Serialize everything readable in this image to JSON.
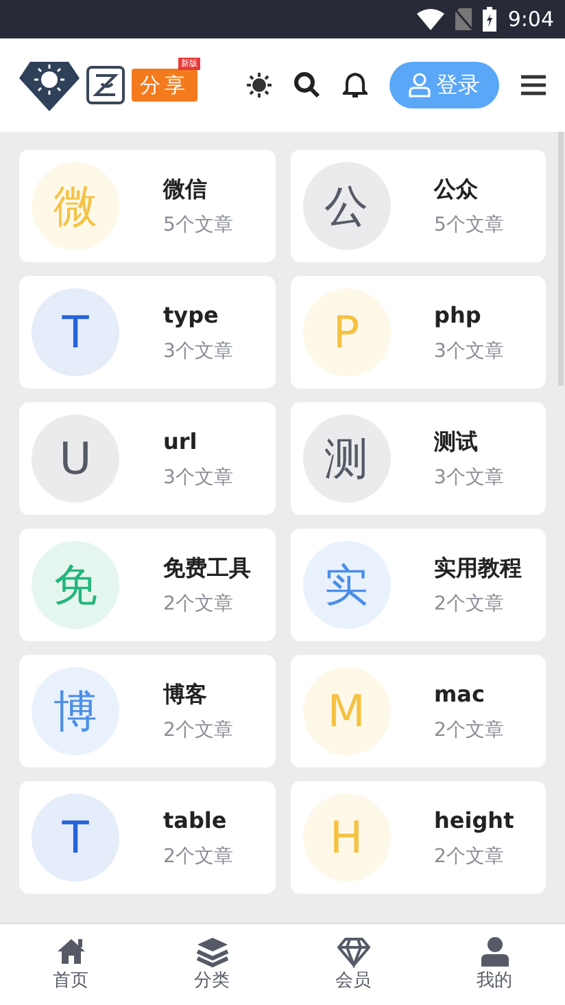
{
  "status_bar": {
    "time": "9:04"
  },
  "header": {
    "logo_text": "分享",
    "logo_tag": "新版",
    "login_label": "登录"
  },
  "categories": [
    {
      "letter": "微",
      "name": "微信",
      "count": "5个文章",
      "color": "#f5c242"
    },
    {
      "letter": "公",
      "name": "公众",
      "count": "5个文章",
      "color": "#555a66"
    },
    {
      "letter": "T",
      "name": "type",
      "count": "3个文章",
      "color": "#2563d9"
    },
    {
      "letter": "P",
      "name": "php",
      "count": "3个文章",
      "color": "#f5c242"
    },
    {
      "letter": "U",
      "name": "url",
      "count": "3个文章",
      "color": "#555a66"
    },
    {
      "letter": "测",
      "name": "测试",
      "count": "3个文章",
      "color": "#555a66"
    },
    {
      "letter": "免",
      "name": "免费工具",
      "count": "2个文章",
      "color": "#23b67a"
    },
    {
      "letter": "实",
      "name": "实用教程",
      "count": "2个文章",
      "color": "#4a8ee8"
    },
    {
      "letter": "博",
      "name": "博客",
      "count": "2个文章",
      "color": "#4a8ee8"
    },
    {
      "letter": "M",
      "name": "mac",
      "count": "2个文章",
      "color": "#f5c242"
    },
    {
      "letter": "T",
      "name": "table",
      "count": "2个文章",
      "color": "#2563d9"
    },
    {
      "letter": "H",
      "name": "height",
      "count": "2个文章",
      "color": "#f5c242"
    }
  ],
  "bottom_nav": [
    {
      "kind": "home",
      "label": "首页"
    },
    {
      "kind": "layers",
      "label": "分类"
    },
    {
      "kind": "diamond",
      "label": "会员"
    },
    {
      "kind": "user",
      "label": "我的"
    }
  ]
}
